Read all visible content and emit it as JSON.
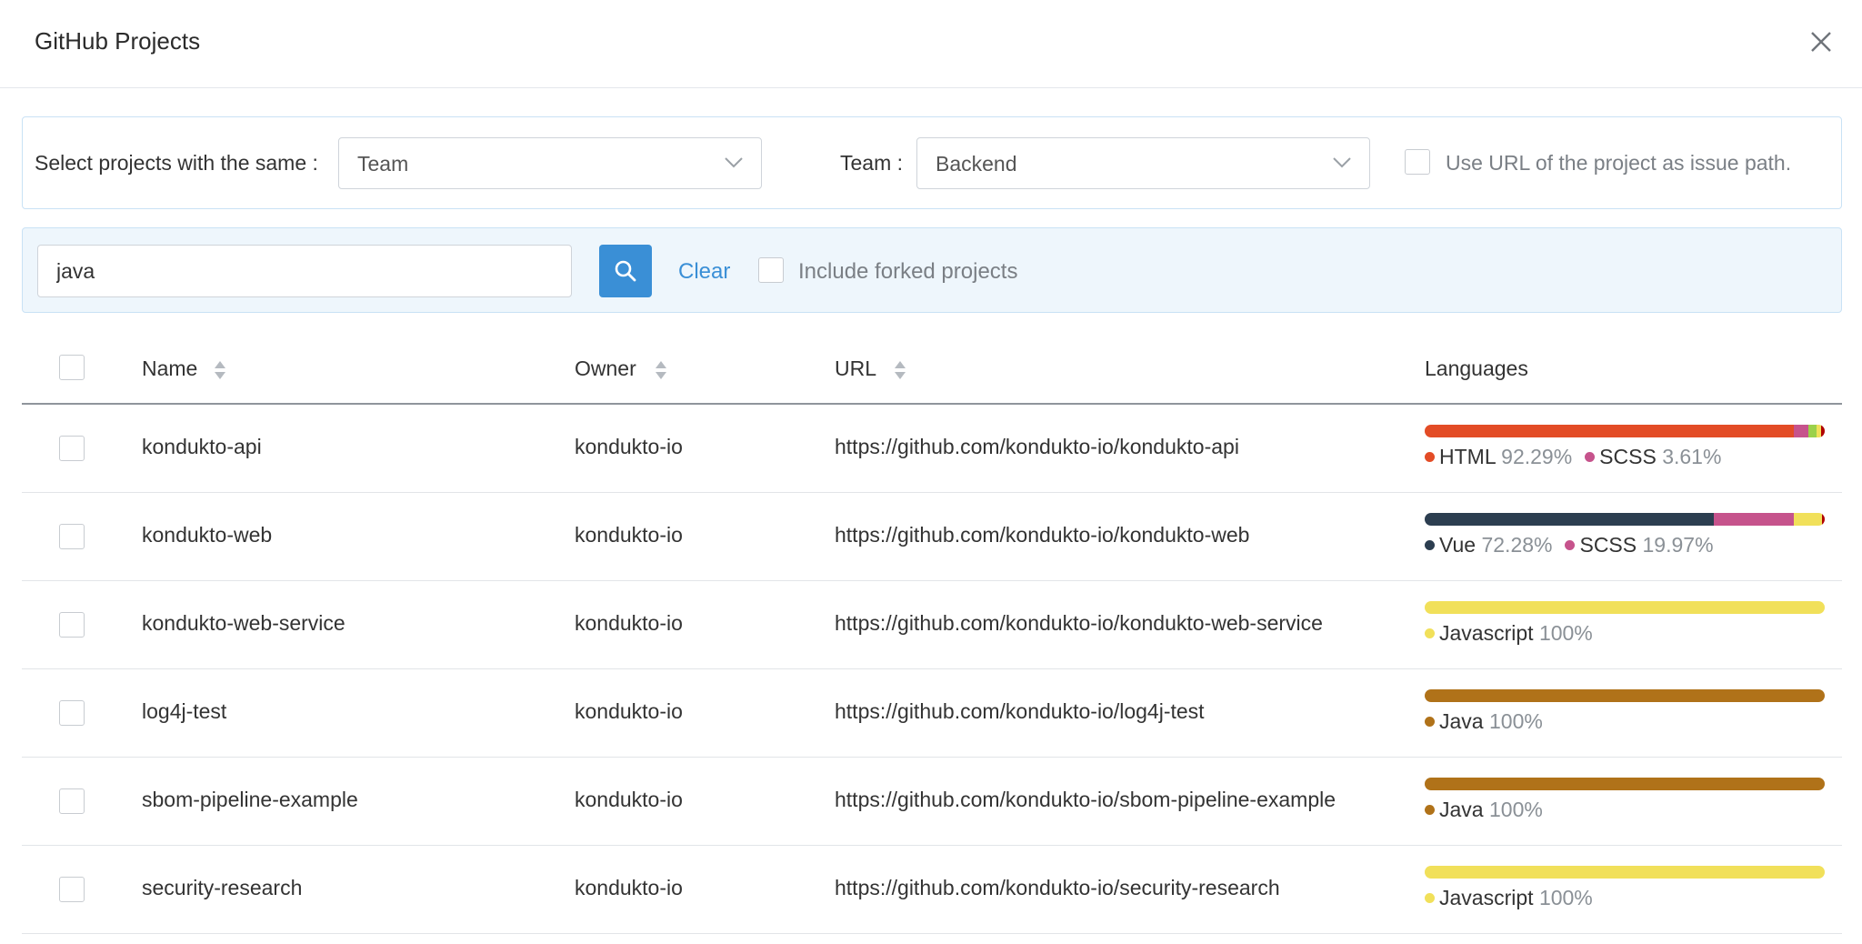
{
  "dialog": {
    "title": "GitHub Projects"
  },
  "filter": {
    "select_label": "Select projects with the same :",
    "select_value": "Team",
    "team_label": "Team :",
    "team_value": "Backend",
    "use_url_label": "Use URL of the project as issue path."
  },
  "search": {
    "value": "java",
    "clear_label": "Clear",
    "include_forked_label": "Include forked projects"
  },
  "table": {
    "headers": {
      "name": "Name",
      "owner": "Owner",
      "url": "URL",
      "languages": "Languages"
    },
    "rows": [
      {
        "name": "kondukto-api",
        "owner": "kondukto-io",
        "url": "https://github.com/kondukto-io/kondukto-api",
        "bar": [
          {
            "color": "#e34c26",
            "pct": 92.29
          },
          {
            "color": "#c6538c",
            "pct": 3.61
          },
          {
            "color": "#9bd14a",
            "pct": 2.0
          },
          {
            "color": "#f1e05a",
            "pct": 1.2
          },
          {
            "color": "#b00000",
            "pct": 0.9
          }
        ],
        "legend": [
          {
            "label": "HTML",
            "pct": "92.29%",
            "color": "#e34c26"
          },
          {
            "label": "SCSS",
            "pct": "3.61%",
            "color": "#c6538c"
          }
        ]
      },
      {
        "name": "kondukto-web",
        "owner": "kondukto-io",
        "url": "https://github.com/kondukto-io/kondukto-web",
        "bar": [
          {
            "color": "#2c3e50",
            "pct": 72.28
          },
          {
            "color": "#c6538c",
            "pct": 19.97
          },
          {
            "color": "#f1e05a",
            "pct": 7.0
          },
          {
            "color": "#b00000",
            "pct": 0.75
          }
        ],
        "legend": [
          {
            "label": "Vue",
            "pct": "72.28%",
            "color": "#2c3e50"
          },
          {
            "label": "SCSS",
            "pct": "19.97%",
            "color": "#c6538c"
          }
        ]
      },
      {
        "name": "kondukto-web-service",
        "owner": "kondukto-io",
        "url": "https://github.com/kondukto-io/kondukto-web-service",
        "bar": [
          {
            "color": "#f1e05a",
            "pct": 100
          }
        ],
        "legend": [
          {
            "label": "Javascript",
            "pct": "100%",
            "color": "#f1e05a"
          }
        ]
      },
      {
        "name": "log4j-test",
        "owner": "kondukto-io",
        "url": "https://github.com/kondukto-io/log4j-test",
        "bar": [
          {
            "color": "#b07219",
            "pct": 100
          }
        ],
        "legend": [
          {
            "label": "Java",
            "pct": "100%",
            "color": "#b07219"
          }
        ]
      },
      {
        "name": "sbom-pipeline-example",
        "owner": "kondukto-io",
        "url": "https://github.com/kondukto-io/sbom-pipeline-example",
        "bar": [
          {
            "color": "#b07219",
            "pct": 100
          }
        ],
        "legend": [
          {
            "label": "Java",
            "pct": "100%",
            "color": "#b07219"
          }
        ]
      },
      {
        "name": "security-research",
        "owner": "kondukto-io",
        "url": "https://github.com/kondukto-io/security-research",
        "bar": [
          {
            "color": "#f1e05a",
            "pct": 100
          }
        ],
        "legend": [
          {
            "label": "Javascript",
            "pct": "100%",
            "color": "#f1e05a"
          }
        ]
      }
    ]
  }
}
